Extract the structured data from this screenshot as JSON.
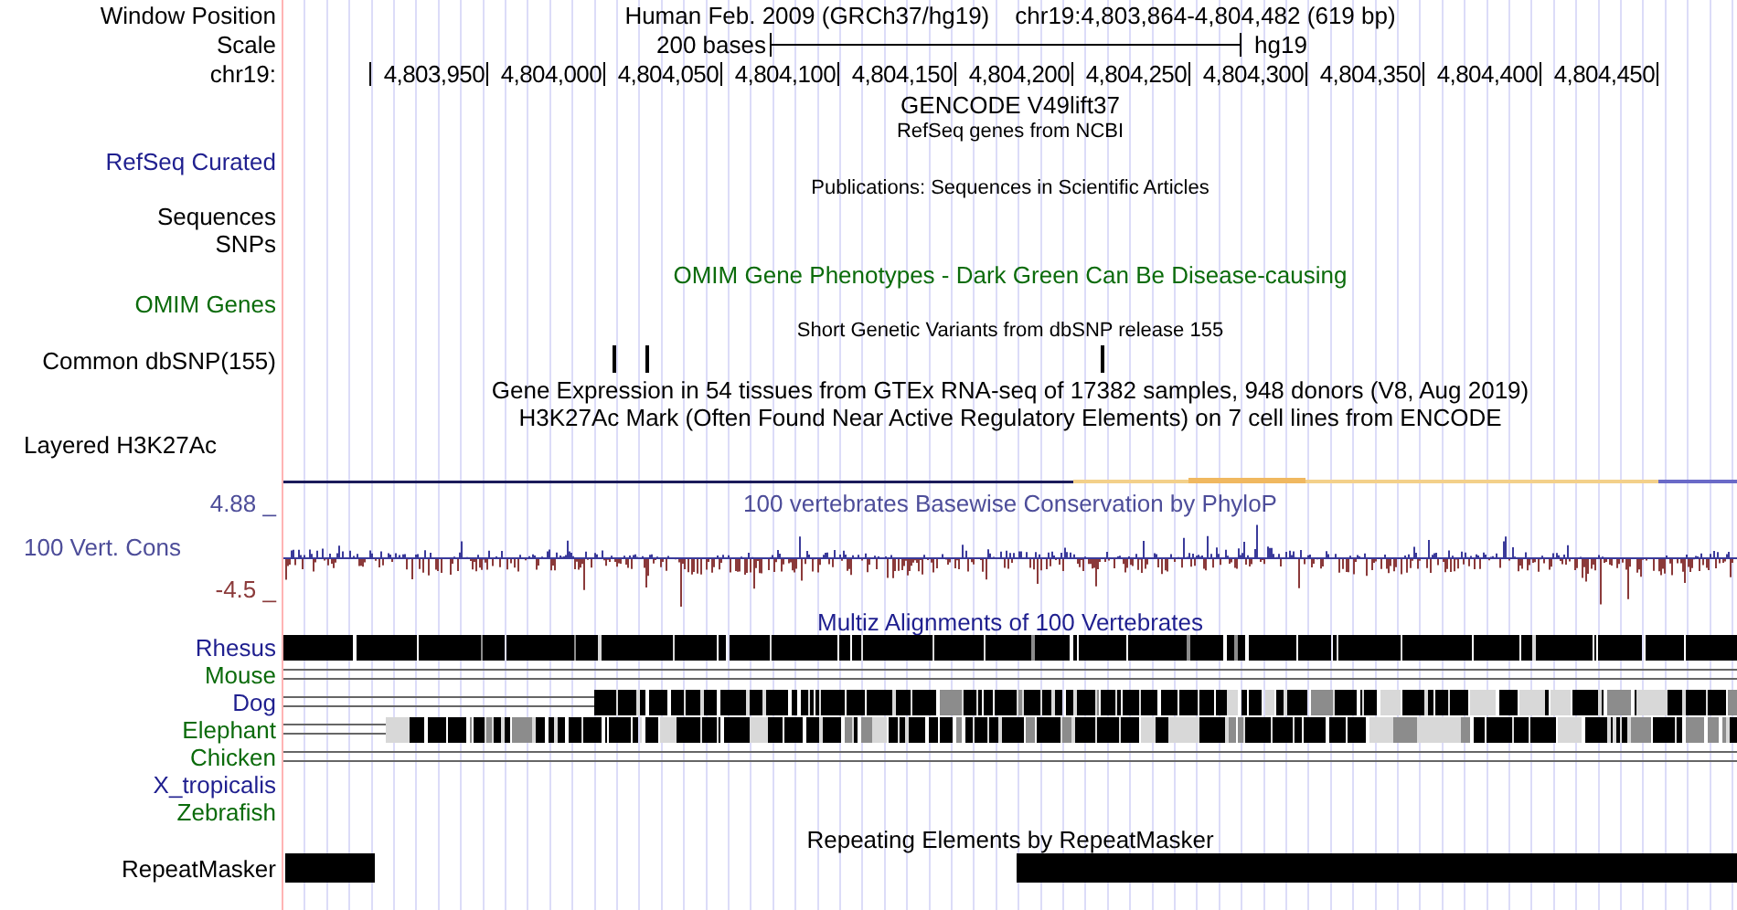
{
  "header": {
    "window_label": "Window Position",
    "assembly": "Human Feb. 2009 (GRCh37/hg19)",
    "position": "chr19:4,803,864-4,804,482 (619 bp)",
    "scale_label": "Scale",
    "scale_text": "200 bases",
    "scale_assembly": "hg19",
    "chrom_label": "chr19:",
    "ruler": [
      "4,803,950",
      "4,804,000",
      "4,804,050",
      "4,804,100",
      "4,804,150",
      "4,804,200",
      "4,804,250",
      "4,804,300",
      "4,804,350",
      "4,804,400",
      "4,804,450"
    ]
  },
  "tracks": [
    {
      "kind": "title",
      "text": "GENCODE V49lift37"
    },
    {
      "kind": "subtitle",
      "text": "RefSeq genes from NCBI"
    },
    {
      "kind": "label",
      "text": "RefSeq Curated",
      "color": "#1f1f8f"
    },
    {
      "kind": "subtitle",
      "text": "Publications: Sequences in Scientific Articles"
    },
    {
      "kind": "label",
      "text": "Sequences",
      "color": "#000000"
    },
    {
      "kind": "label",
      "text": "SNPs",
      "color": "#000000"
    },
    {
      "kind": "title",
      "text": "OMIM Gene Phenotypes - Dark Green Can Be Disease-causing",
      "color": "#0b6b0b"
    },
    {
      "kind": "label",
      "text": "OMIM Genes",
      "color": "#0b6b0b"
    },
    {
      "kind": "subtitle",
      "text": "Short Genetic Variants from dbSNP release 155"
    },
    {
      "kind": "snps",
      "text": "Common dbSNP(155)",
      "color": "#000000"
    },
    {
      "kind": "title",
      "text": "Gene Expression in 54 tissues from GTEx RNA-seq of 17382 samples, 948 donors (V8, Aug 2019)"
    },
    {
      "kind": "title",
      "text": "H3K27Ac Mark (Often Found Near Active Regulatory Elements) on 7 cell lines from ENCODE"
    },
    {
      "kind": "signal-label",
      "text": "Layered H3K27Ac",
      "color": "#000000"
    },
    {
      "kind": "signal"
    },
    {
      "kind": "wiggle",
      "title": "100 vertebrates Basewise Conservation by PhyloP",
      "text": "100 Vert. Cons",
      "max": "4.88 _",
      "min": "-4.5 _"
    },
    {
      "kind": "title",
      "text": "Multiz Alignments of 100 Vertebrates",
      "color": "#1f1f8f"
    },
    {
      "kind": "aligned",
      "text": "Rhesus",
      "color": "#1f1f8f"
    },
    {
      "kind": "gapped",
      "text": "Mouse",
      "color": "#0b6b0b"
    },
    {
      "kind": "aligned",
      "text": "Dog",
      "color": "#1f1f8f"
    },
    {
      "kind": "aligned",
      "text": "Elephant",
      "color": "#0b6b0b"
    },
    {
      "kind": "gapped",
      "text": "Chicken",
      "color": "#0b6b0b"
    },
    {
      "kind": "unaligned",
      "text": "X_tropicalis",
      "color": "#1f1f8f"
    },
    {
      "kind": "unaligned",
      "text": "Zebrafish",
      "color": "#0b6b0b"
    },
    {
      "kind": "title",
      "text": "Repeating Elements by RepeatMasker"
    },
    {
      "kind": "repeats",
      "text": "RepeatMasker",
      "color": "#000000"
    }
  ]
}
